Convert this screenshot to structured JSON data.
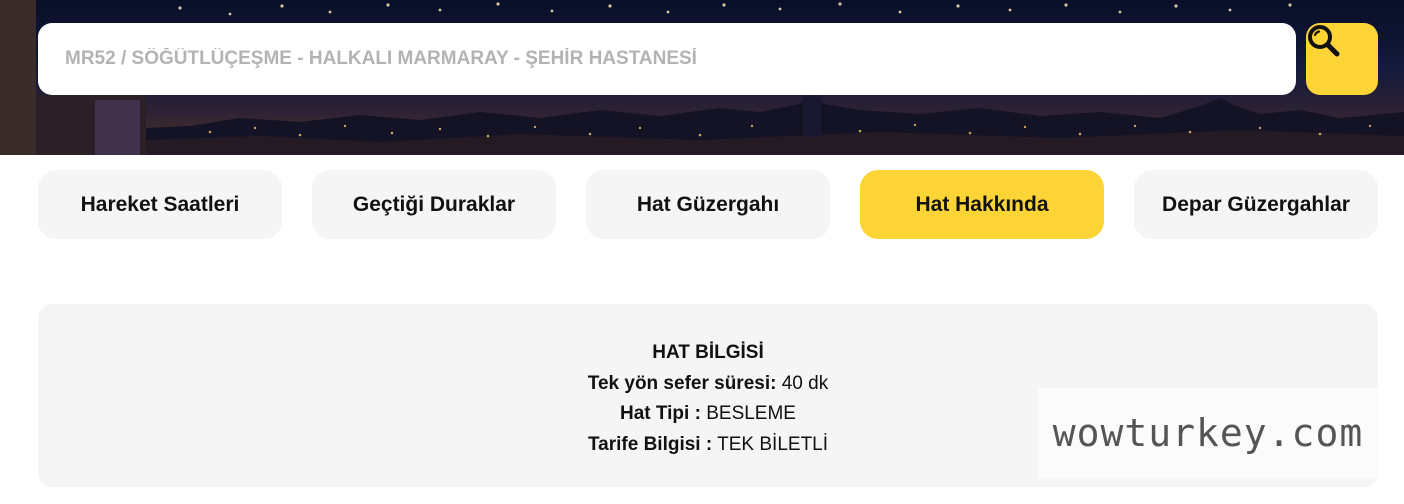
{
  "search": {
    "value": "MR52 / SÖĞÜTLÜÇEŞME - HALKALI MARMARAY - ŞEHİR HASTANESİ",
    "button_icon": "search-icon"
  },
  "tabs": [
    {
      "label": "Hareket Saatleri",
      "active": false
    },
    {
      "label": "Geçtiği Duraklar",
      "active": false
    },
    {
      "label": "Hat Güzergahı",
      "active": false
    },
    {
      "label": "Hat Hakkında",
      "active": true
    },
    {
      "label": "Depar Güzergahlar",
      "active": false
    }
  ],
  "info": {
    "title": "HAT BİLGİSİ",
    "rows": [
      {
        "label": "Tek yön sefer süresi:",
        "value": "40 dk"
      },
      {
        "label": "Hat Tipi :",
        "value": "BESLEME"
      },
      {
        "label": "Tarife Bilgisi :",
        "value": "TEK BİLETLİ"
      }
    ]
  },
  "watermark": "wowturkey.com",
  "colors": {
    "accent": "#fdd436",
    "tab_bg": "#f5f5f5",
    "card_bg": "#f5f5f5",
    "text": "#111111"
  }
}
